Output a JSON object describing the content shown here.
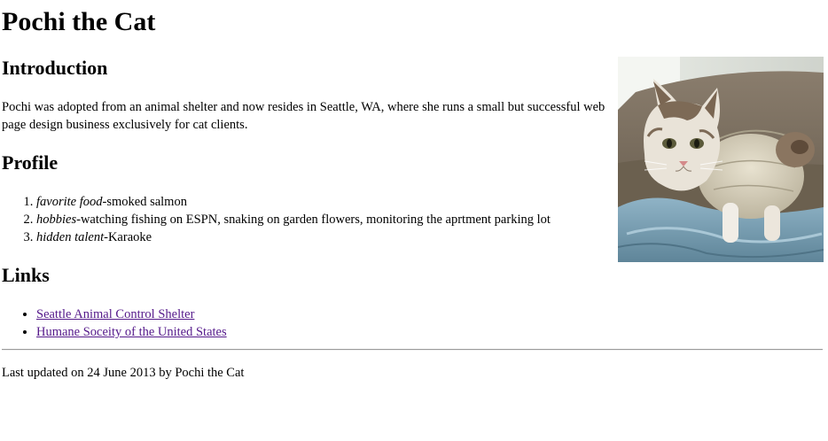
{
  "page": {
    "title": "Pochi the Cat",
    "introduction": {
      "heading": "Introduction",
      "text": "Pochi was adopted from an animal shelter and now resides in Seattle, WA, where she runs a small but successful web page design business exclusively for cat clients."
    },
    "profile": {
      "heading": "Profile",
      "items": [
        {
          "term": "favorite food",
          "value": "-smoked salmon"
        },
        {
          "term": "hobbies",
          "value": "-watching fishing on ESPN, snaking on garden flowers, monitoring the aprtment parking lot"
        },
        {
          "term": "hidden talent",
          "value": "-Karaoke"
        }
      ]
    },
    "links": {
      "heading": "Links",
      "items": [
        {
          "label": "Seattle Animal Control Shelter"
        },
        {
          "label": "Humane Soceity of the United States"
        }
      ]
    },
    "footer": "Last updated on 24 June 2013 by Pochi the Cat"
  },
  "colors": {
    "visited_link": "#551a8b",
    "text": "#000000",
    "background": "#ffffff"
  }
}
